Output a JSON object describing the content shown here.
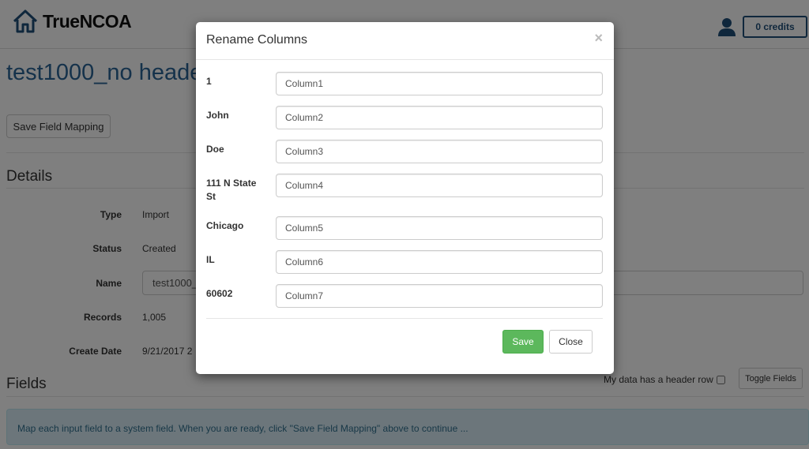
{
  "navbar": {
    "brand": "TrueNCOA",
    "credits_label": "0 credits"
  },
  "page": {
    "title": "test1000_no headers",
    "save_mapping_label": "Save Field Mapping",
    "details_heading": "Details",
    "details": [
      {
        "label": "Type",
        "value": "Import"
      },
      {
        "label": "Status",
        "value": "Created"
      },
      {
        "label": "Name",
        "value": "test1000_no headers"
      },
      {
        "label": "Records",
        "value": "1,005"
      },
      {
        "label": "Create Date",
        "value": "9/21/2017 2"
      }
    ],
    "fields_heading": "Fields",
    "header_row_label": "My data has a header row",
    "header_row_checked": false,
    "toggle_fields_label": "Toggle Fields",
    "info_message": "Map each input field to a system field. When you are ready, click \"Save Field Mapping\" above to continue ..."
  },
  "modal": {
    "title": "Rename Columns",
    "close_symbol": "×",
    "columns": [
      {
        "sample": "1",
        "name": "Column1"
      },
      {
        "sample": "John",
        "name": "Column2"
      },
      {
        "sample": "Doe",
        "name": "Column3"
      },
      {
        "sample": "111 N State St",
        "name": "Column4"
      },
      {
        "sample": "Chicago",
        "name": "Column5"
      },
      {
        "sample": "IL",
        "name": "Column6"
      },
      {
        "sample": "60602",
        "name": "Column7"
      }
    ],
    "save_label": "Save",
    "close_label": "Close"
  },
  "colors": {
    "brand_blue": "#1f4e79",
    "title_blue": "#2a6496",
    "success_green": "#5cb85c"
  }
}
